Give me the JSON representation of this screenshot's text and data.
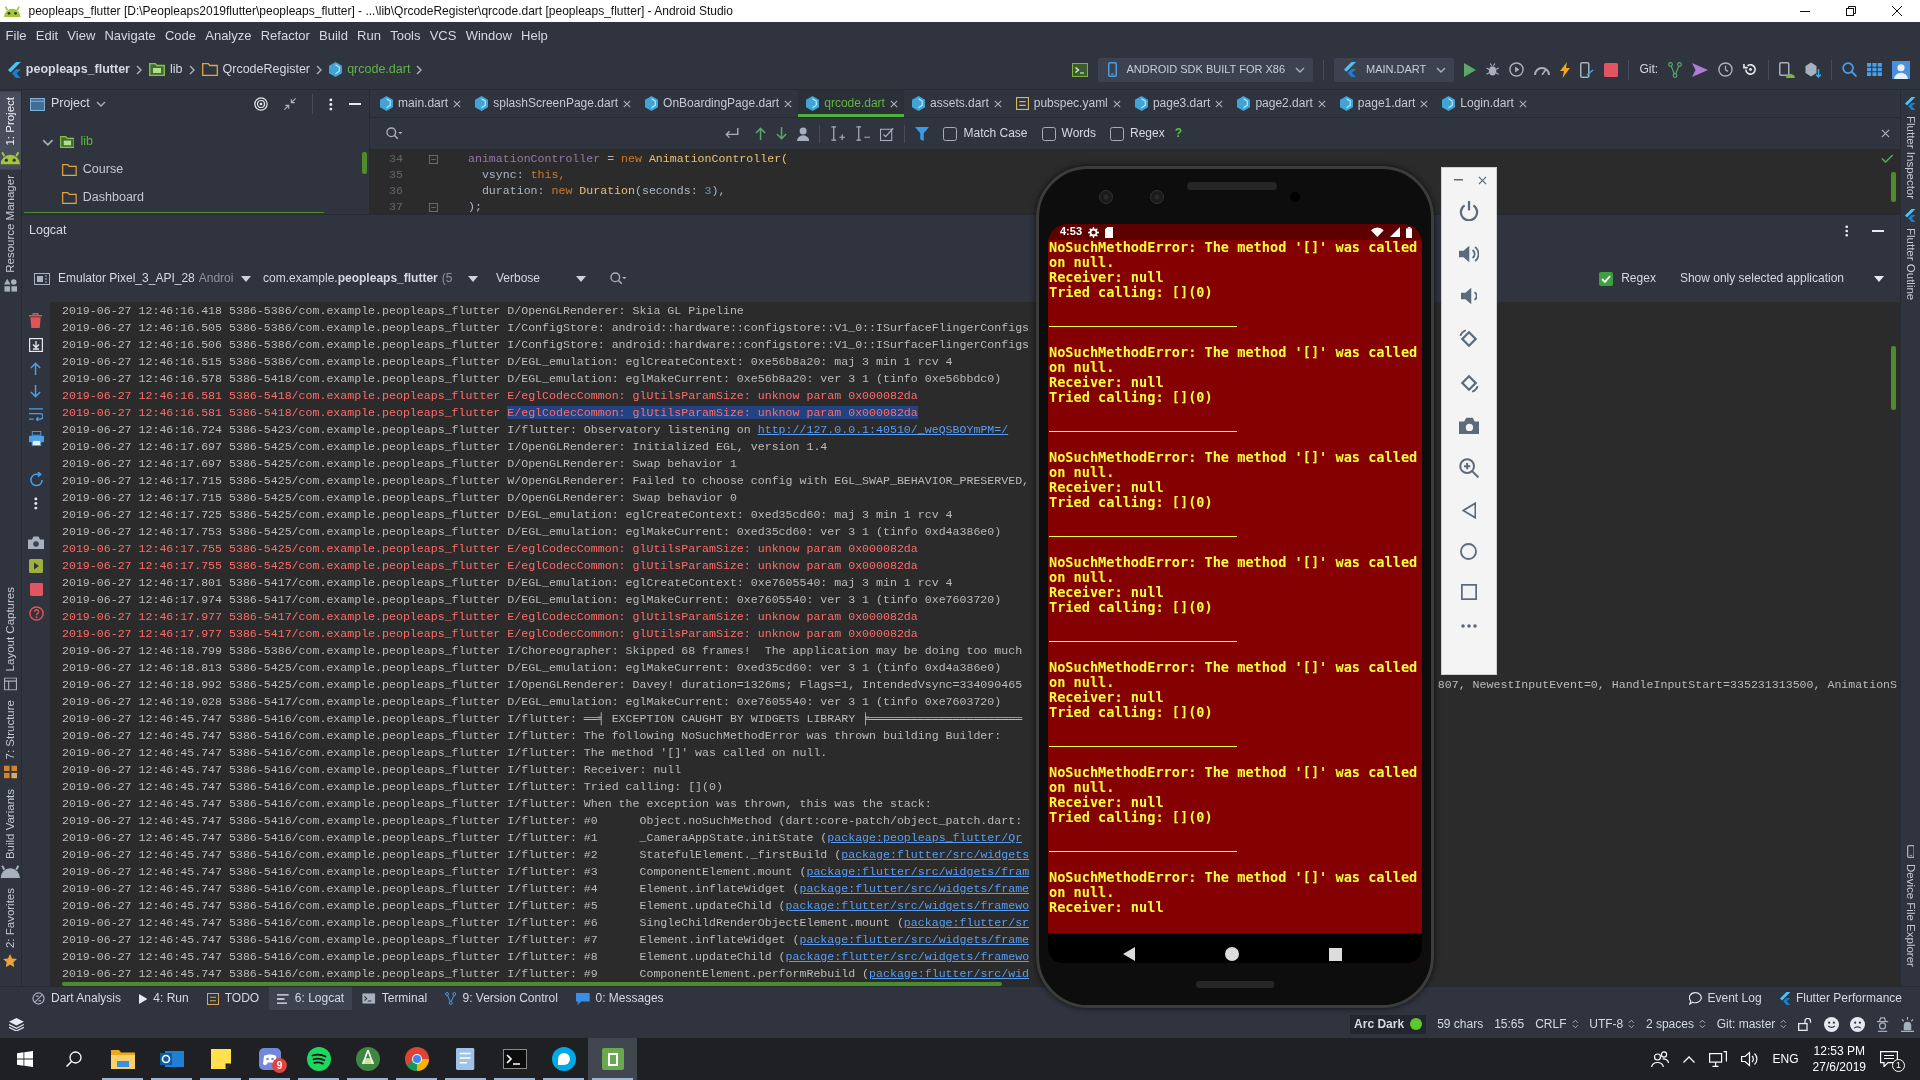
{
  "window": {
    "title": "peopleaps_flutter [D:\\Peopleaps2019flutter\\peopleaps_flutter] - ...\\lib\\QrcodeRegister\\qrcode.dart [peopleaps_flutter] - Android Studio"
  },
  "menu": [
    "File",
    "Edit",
    "View",
    "Navigate",
    "Code",
    "Analyze",
    "Refactor",
    "Build",
    "Run",
    "Tools",
    "VCS",
    "Window",
    "Help"
  ],
  "breadcrumb": [
    {
      "label": "peopleaps_flutter",
      "kind": "project"
    },
    {
      "label": "lib",
      "kind": "source_folder"
    },
    {
      "label": "QrcodeRegister",
      "kind": "folder"
    },
    {
      "label": "qrcode.dart",
      "kind": "file"
    }
  ],
  "toolbar": {
    "device": "ANDROID SDK BUILT FOR X86",
    "run_configuration": "MAIN.DART",
    "vcs_label": "Git:"
  },
  "left_tool_strip": {
    "top": [
      {
        "label": "1: Project",
        "selected": true
      },
      {
        "label": "Resource Manager",
        "selected": false
      }
    ],
    "bottom": [
      {
        "label": "Layout Captures",
        "selected": false
      },
      {
        "label": "7: Structure",
        "selected": false
      },
      {
        "label": "Build Variants",
        "selected": false
      },
      {
        "label": "2: Favorites",
        "selected": false
      }
    ]
  },
  "right_tool_strip": {
    "top": [
      {
        "label": "Flutter Inspector",
        "selected": false
      },
      {
        "label": "Flutter Outline",
        "selected": false
      }
    ],
    "bottom": [
      {
        "label": "Device File Explorer",
        "selected": false
      }
    ]
  },
  "project_panel": {
    "title": "Project",
    "tree": [
      {
        "label": "lib",
        "kind": "source_folder",
        "expanded": true,
        "children": [
          {
            "label": "Course",
            "kind": "folder"
          },
          {
            "label": "Dashboard",
            "kind": "folder"
          }
        ]
      }
    ]
  },
  "editor": {
    "tabs": [
      {
        "label": "main.dart",
        "kind": "dart",
        "selected": false
      },
      {
        "label": "splashScreenPage.dart",
        "kind": "dart",
        "selected": false
      },
      {
        "label": "OnBoardingPage.dart",
        "kind": "dart",
        "selected": false
      },
      {
        "label": "qrcode.dart",
        "kind": "dart",
        "selected": true
      },
      {
        "label": "assets.dart",
        "kind": "dart",
        "selected": false
      },
      {
        "label": "pubspec.yaml",
        "kind": "yaml",
        "selected": false
      },
      {
        "label": "page3.dart",
        "kind": "dart",
        "selected": false
      },
      {
        "label": "page2.dart",
        "kind": "dart",
        "selected": false
      },
      {
        "label": "page1.dart",
        "kind": "dart",
        "selected": false
      },
      {
        "label": "Login.dart",
        "kind": "dart",
        "selected": false
      }
    ],
    "find_bar": {
      "options": [
        {
          "label": "Match Case",
          "checked": false
        },
        {
          "label": "Words",
          "checked": false
        },
        {
          "label": "Regex",
          "checked": false
        }
      ],
      "help": "?"
    },
    "code": [
      {
        "number": "34",
        "fold": true,
        "tokens": [
          {
            "kind": "field",
            "text": "animationController"
          },
          {
            "kind": "plain",
            "text": " = "
          },
          {
            "kind": "keyword",
            "text": "new"
          },
          {
            "kind": "class",
            "text": " AnimationController("
          }
        ]
      },
      {
        "number": "35",
        "fold": false,
        "tokens": [
          {
            "kind": "plain",
            "text": "  vsync: "
          },
          {
            "kind": "keyword",
            "text": "this,"
          }
        ]
      },
      {
        "number": "36",
        "fold": false,
        "tokens": [
          {
            "kind": "plain",
            "text": "  duration: "
          },
          {
            "kind": "keyword",
            "text": "new"
          },
          {
            "kind": "class",
            "text": " Duration"
          },
          {
            "kind": "plain",
            "text": "(seconds: "
          },
          {
            "kind": "number",
            "text": "3"
          },
          {
            "kind": "plain",
            "text": "),"
          }
        ]
      },
      {
        "number": "37",
        "fold": true,
        "tokens": [
          {
            "kind": "plain",
            "text": ");"
          }
        ]
      }
    ]
  },
  "logcat": {
    "title": "Logcat",
    "device": {
      "name": "Emulator Pixel_3_API_28",
      "detail": "Androi"
    },
    "process": {
      "name": "com.example.**peopleaps_flutter**",
      "detail": "(5"
    },
    "log_level": "Verbose",
    "regex": {
      "label": "Regex",
      "checked": true
    },
    "filter": "Show only selected application",
    "lines": [
      {
        "kind": "normal",
        "text": "2019-06-27 12:46:16.418 5386-5386/com.example.peopleaps_flutter D/OpenGLRenderer: Skia GL Pipeline"
      },
      {
        "kind": "normal",
        "text": "2019-06-27 12:46:16.505 5386-5386/com.example.peopleaps_flutter I/ConfigStore: android::hardware::configstore::V1_0::ISurfaceFlingerConfigs"
      },
      {
        "kind": "normal",
        "text": "2019-06-27 12:46:16.506 5386-5386/com.example.peopleaps_flutter I/ConfigStore: android::hardware::configstore::V1_0::ISurfaceFlingerConfigs"
      },
      {
        "kind": "normal",
        "text": "2019-06-27 12:46:16.515 5386-5386/com.example.peopleaps_flutter D/EGL_emulation: eglCreateContext: 0xe56b8a20: maj 3 min 1 rcv 4"
      },
      {
        "kind": "normal",
        "text": "2019-06-27 12:46:16.578 5386-5418/com.example.peopleaps_flutter D/EGL_emulation: eglMakeCurrent: 0xe56b8a20: ver 3 1 (tinfo 0xe56bbdc0)"
      },
      {
        "kind": "error",
        "text": "2019-06-27 12:46:16.581 5386-5418/com.example.peopleaps_flutter E/eglCodecCommon: glUtilsParamSize: unknow param 0x000082da"
      },
      {
        "kind": "error",
        "parts": [
          {
            "kind": "plain",
            "text": "2019-06-27 12:46:16.581 5386-5418/com.example.peopleaps_flutter "
          },
          {
            "kind": "selected",
            "text": "E/eglCodecCommon: glUtilsParamSize: unknow param 0x000082da"
          }
        ]
      },
      {
        "kind": "normal",
        "parts": [
          {
            "kind": "plain",
            "text": "2019-06-27 12:46:16.724 5386-5423/com.example.peopleaps_flutter I/flutter: Observatory listening on "
          },
          {
            "kind": "link",
            "text": "http://127.0.0.1:40510/_weQSBOYmPM=/"
          }
        ]
      },
      {
        "kind": "normal",
        "text": "2019-06-27 12:46:17.697 5386-5425/com.example.peopleaps_flutter I/OpenGLRenderer: Initialized EGL, version 1.4"
      },
      {
        "kind": "normal",
        "text": "2019-06-27 12:46:17.697 5386-5425/com.example.peopleaps_flutter D/OpenGLRenderer: Swap behavior 1"
      },
      {
        "kind": "normal",
        "text": "2019-06-27 12:46:17.715 5386-5425/com.example.peopleaps_flutter W/OpenGLRenderer: Failed to choose config with EGL_SWAP_BEHAVIOR_PRESERVED,"
      },
      {
        "kind": "normal",
        "text": "2019-06-27 12:46:17.715 5386-5425/com.example.peopleaps_flutter D/OpenGLRenderer: Swap behavior 0"
      },
      {
        "kind": "normal",
        "text": "2019-06-27 12:46:17.725 5386-5425/com.example.peopleaps_flutter D/EGL_emulation: eglCreateContext: 0xed35cd60: maj 3 min 1 rcv 4"
      },
      {
        "kind": "normal",
        "text": "2019-06-27 12:46:17.753 5386-5425/com.example.peopleaps_flutter D/EGL_emulation: eglMakeCurrent: 0xed35cd60: ver 3 1 (tinfo 0xd4a386e0)"
      },
      {
        "kind": "error",
        "text": "2019-06-27 12:46:17.755 5386-5425/com.example.peopleaps_flutter E/eglCodecCommon: glUtilsParamSize: unknow param 0x000082da"
      },
      {
        "kind": "error",
        "text": "2019-06-27 12:46:17.755 5386-5425/com.example.peopleaps_flutter E/eglCodecCommon: glUtilsParamSize: unknow param 0x000082da"
      },
      {
        "kind": "normal",
        "text": "2019-06-27 12:46:17.801 5386-5417/com.example.peopleaps_flutter D/EGL_emulation: eglCreateContext: 0xe7605540: maj 3 min 1 rcv 4"
      },
      {
        "kind": "normal",
        "text": "2019-06-27 12:46:17.974 5386-5417/com.example.peopleaps_flutter D/EGL_emulation: eglMakeCurrent: 0xe7605540: ver 3 1 (tinfo 0xe7603720)"
      },
      {
        "kind": "error",
        "text": "2019-06-27 12:46:17.977 5386-5417/com.example.peopleaps_flutter E/eglCodecCommon: glUtilsParamSize: unknow param 0x000082da"
      },
      {
        "kind": "error",
        "text": "2019-06-27 12:46:17.977 5386-5417/com.example.peopleaps_flutter E/eglCodecCommon: glUtilsParamSize: unknow param 0x000082da"
      },
      {
        "kind": "normal",
        "text": "2019-06-27 12:46:18.799 5386-5386/com.example.peopleaps_flutter I/Choreographer: Skipped 68 frames!  The application may be doing too much"
      },
      {
        "kind": "normal",
        "text": "2019-06-27 12:46:18.813 5386-5425/com.example.peopleaps_flutter D/EGL_emulation: eglMakeCurrent: 0xed35cd60: ver 3 1 (tinfo 0xd4a386e0)"
      },
      {
        "kind": "normal",
        "text": "2019-06-27 12:46:18.992 5386-5425/com.example.peopleaps_flutter I/OpenGLRenderer: Davey! duration=1326ms; Flags=1, IntendedVsync=334090465",
        "right_fragment": "807, NewestInputEvent=0, HandleInputStart=335231313500, AnimationS"
      },
      {
        "kind": "normal",
        "text": "2019-06-27 12:46:19.028 5386-5417/com.example.peopleaps_flutter D/EGL_emulation: eglMakeCurrent: 0xe7605540: ver 3 1 (tinfo 0xe7603720)"
      },
      {
        "kind": "normal",
        "text": "2019-06-27 12:46:45.747 5386-5416/com.example.peopleaps_flutter I/flutter: ══╡ EXCEPTION CAUGHT BY WIDGETS LIBRARY ╞══════════════════════"
      },
      {
        "kind": "normal",
        "text": "2019-06-27 12:46:45.747 5386-5416/com.example.peopleaps_flutter I/flutter: The following NoSuchMethodError was thrown building Builder:"
      },
      {
        "kind": "normal",
        "text": "2019-06-27 12:46:45.747 5386-5416/com.example.peopleaps_flutter I/flutter: The method '[]' was called on null."
      },
      {
        "kind": "normal",
        "text": "2019-06-27 12:46:45.747 5386-5416/com.example.peopleaps_flutter I/flutter: Receiver: null"
      },
      {
        "kind": "normal",
        "text": "2019-06-27 12:46:45.747 5386-5416/com.example.peopleaps_flutter I/flutter: Tried calling: [](0)"
      },
      {
        "kind": "normal",
        "text": "2019-06-27 12:46:45.747 5386-5416/com.example.peopleaps_flutter I/flutter: When the exception was thrown, this was the stack:"
      },
      {
        "kind": "normal",
        "text": "2019-06-27 12:46:45.747 5386-5416/com.example.peopleaps_flutter I/flutter: #0      Object.noSuchMethod (dart:core-patch/object_patch.dart:"
      },
      {
        "kind": "normal",
        "parts": [
          {
            "kind": "plain",
            "text": "2019-06-27 12:46:45.747 5386-5416/com.example.peopleaps_flutter I/flutter: #1      _CameraAppState.initState ("
          },
          {
            "kind": "link",
            "text": "package:peopleaps_flutter/Qr"
          }
        ]
      },
      {
        "kind": "normal",
        "parts": [
          {
            "kind": "plain",
            "text": "2019-06-27 12:46:45.747 5386-5416/com.example.peopleaps_flutter I/flutter: #2      StatefulElement._firstBuild ("
          },
          {
            "kind": "link",
            "text": "package:flutter/src/widgets"
          }
        ]
      },
      {
        "kind": "normal",
        "parts": [
          {
            "kind": "plain",
            "text": "2019-06-27 12:46:45.747 5386-5416/com.example.peopleaps_flutter I/flutter: #3      ComponentElement.mount ("
          },
          {
            "kind": "link",
            "text": "package:flutter/src/widgets/fram"
          }
        ]
      },
      {
        "kind": "normal",
        "parts": [
          {
            "kind": "plain",
            "text": "2019-06-27 12:46:45.747 5386-5416/com.example.peopleaps_flutter I/flutter: #4      Element.inflateWidget ("
          },
          {
            "kind": "link",
            "text": "package:flutter/src/widgets/frame"
          }
        ]
      },
      {
        "kind": "normal",
        "parts": [
          {
            "kind": "plain",
            "text": "2019-06-27 12:46:45.747 5386-5416/com.example.peopleaps_flutter I/flutter: #5      Element.updateChild ("
          },
          {
            "kind": "link",
            "text": "package:flutter/src/widgets/framewo"
          }
        ]
      },
      {
        "kind": "normal",
        "parts": [
          {
            "kind": "plain",
            "text": "2019-06-27 12:46:45.747 5386-5416/com.example.peopleaps_flutter I/flutter: #6      SingleChildRenderObjectElement.mount ("
          },
          {
            "kind": "link",
            "text": "package:flutter/sr"
          }
        ]
      },
      {
        "kind": "normal",
        "parts": [
          {
            "kind": "plain",
            "text": "2019-06-27 12:46:45.747 5386-5416/com.example.peopleaps_flutter I/flutter: #7      Element.inflateWidget ("
          },
          {
            "kind": "link",
            "text": "package:flutter/src/widgets/frame"
          }
        ]
      },
      {
        "kind": "normal",
        "parts": [
          {
            "kind": "plain",
            "text": "2019-06-27 12:46:45.747 5386-5416/com.example.peopleaps_flutter I/flutter: #8      Element.updateChild ("
          },
          {
            "kind": "link",
            "text": "package:flutter/src/widgets/framewo"
          }
        ]
      },
      {
        "kind": "normal",
        "parts": [
          {
            "kind": "plain",
            "text": "2019-06-27 12:46:45.747 5386-5416/com.example.peopleaps_flutter I/flutter: #9      ComponentElement.performRebuild ("
          },
          {
            "kind": "link",
            "text": "package:flutter/src/wid"
          }
        ]
      }
    ]
  },
  "emulator": {
    "status_time": "4:53",
    "error_blocks": [
      {
        "lines": [
          "NoSuchMethodError: The method '[]' was called on null.",
          "Receiver: null",
          "Tried calling: [](0)"
        ]
      },
      {
        "lines": [
          "NoSuchMethodError: The method '[]' was called on null.",
          "Receiver: null",
          "Tried calling: [](0)"
        ]
      },
      {
        "lines": [
          "NoSuchMethodError: The method '[]' was called on null.",
          "Receiver: null",
          "Tried calling: [](0)"
        ]
      },
      {
        "lines": [
          "NoSuchMethodError: The method '[]' was called on null.",
          "Receiver: null",
          "Tried calling: [](0)"
        ]
      },
      {
        "lines": [
          "NoSuchMethodError: The method '[]' was called on null.",
          "Receiver: null",
          "Tried calling: [](0)"
        ]
      },
      {
        "lines": [
          "NoSuchMethodError: The method '[]' was called on null.",
          "Receiver: null",
          "Tried calling: [](0)"
        ]
      },
      {
        "lines": [
          "NoSuchMethodError: The method '[]' was called on null.",
          "Receiver: null"
        ]
      }
    ]
  },
  "tool_window_bar": {
    "left": [
      {
        "label": "Dart Analysis",
        "selected": false
      },
      {
        "label": "4: Run",
        "selected": false
      },
      {
        "label": "TODO",
        "selected": false
      },
      {
        "label": "6: Logcat",
        "selected": true
      },
      {
        "label": "Terminal",
        "selected": false
      },
      {
        "label": "9: Version Control",
        "selected": false
      },
      {
        "label": "0: Messages",
        "selected": false
      }
    ],
    "right": [
      {
        "label": "Event Log",
        "selected": false
      },
      {
        "label": "Flutter Performance",
        "selected": false
      }
    ]
  },
  "status_bar": {
    "theme": "Arc Dark",
    "items": [
      {
        "label": "59 chars",
        "dropdown": false
      },
      {
        "label": "15:65",
        "dropdown": false
      },
      {
        "label": "CRLF",
        "dropdown": true
      },
      {
        "label": "UTF-8",
        "dropdown": true
      },
      {
        "label": "2 spaces",
        "dropdown": true
      },
      {
        "label": "Git: master",
        "dropdown": true
      }
    ]
  },
  "taskbar": {
    "apps": [
      {
        "running": true,
        "selected": false
      },
      {
        "running": true,
        "selected": false
      },
      {
        "running": true,
        "selected": false
      },
      {
        "running": true,
        "selected": false,
        "badge": "9"
      },
      {
        "running": true,
        "selected": false
      },
      {
        "running": true,
        "selected": false
      },
      {
        "running": true,
        "selected": false
      },
      {
        "running": true,
        "selected": false
      },
      {
        "running": true,
        "selected": false
      },
      {
        "running": true,
        "selected": false
      },
      {
        "running": true,
        "selected": true
      }
    ],
    "language": "ENG",
    "time": "12:53 PM",
    "date": "27/6/2019",
    "notifications": "1"
  }
}
